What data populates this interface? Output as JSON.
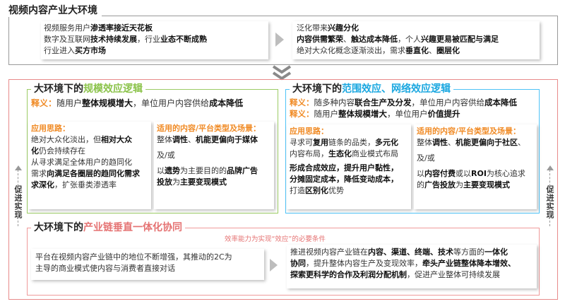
{
  "top": {
    "title": "视频内容产业大环境",
    "left": {
      "l1a": "视频服务用户",
      "l1b": "渗透率接近天花板",
      "l2a": "数字及互联网",
      "l2b": "技术持续发展",
      "l2c": "，行业",
      "l2d": "业态不断成熟",
      "l3a": "行业进入",
      "l3b": "买方市场"
    },
    "right": {
      "l1a": "泛化带来",
      "l1b": "兴趣分化",
      "l2a": "内容供需繁荣",
      "l2b": "、",
      "l2c": "触达成本降低",
      "l2d": "，个人",
      "l2e": "兴趣更易被匹配与满足",
      "l3a": "绝对大众化概念逐渐淡出，需求",
      "l3b": "垂直化",
      "l3c": "、",
      "l3d": "圈层化"
    }
  },
  "side": {
    "left_label": "促进实现",
    "right_label": "促进实现"
  },
  "scale": {
    "title_a": "大环境下的",
    "title_b": "规模效应逻辑",
    "def_k": "释义：",
    "def_a": "随用户",
    "def_b": "整体规模增大",
    "def_c": "，单位用户内容供给",
    "def_d": "成本降低",
    "idea_k": "应用思路：",
    "i1a": "绝对大众化淡出，但",
    "i1b": "相对大众",
    "i2a": "化",
    "i2b": "仍会持续存在",
    "i3": "从寻求满足全体用户的趋同化",
    "i4a": "需求",
    "i4b": "向满足各圈层的趋同化需求",
    "i5a": "求深化",
    "i5b": "，扩张垂类渗透率",
    "fit_k": "适用的内容/平台类型及场景：",
    "f1a": "整体",
    "f1b": "调性",
    "f1c": "、",
    "f1d": "机能更偏向于媒体",
    "f2": "及/或",
    "f3a": "以",
    "f3b": "遗势",
    "f3c": "为主要目的的",
    "f3d": "品牌广告",
    "f4a": "投放",
    "f4b": "为",
    "f4c": "主要变现模式"
  },
  "scope": {
    "title_a": "大环境下的",
    "title_b": "范围效应、网络效应逻辑",
    "d1k": "释义：",
    "d1a": "随多种内容",
    "d1b": "联合生产及分发",
    "d1c": "，单位用户内容供给",
    "d1d": "成本降低",
    "d2k": "释义：",
    "d2a": "随用户",
    "d2b": "整体规模增大",
    "d2c": "，单位用户",
    "d2d": "价值提升",
    "idea_k": "应用思路：",
    "i1a": "寻求可",
    "i1b": "复用",
    "i1c": "链条的品类，",
    "i1d": "多元化",
    "i2a": "内容布局，",
    "i2b": "生态化",
    "i2c": "商业模式布局",
    "i3": "形成合成效应，提升用户黏性，",
    "i4": "分摊固定成本，降低变动成本，",
    "i5a": "打造",
    "i5b": "区别化",
    "i5c": "优势",
    "fit_k": "适用的内容/平台类型及场景：",
    "f1a": "整体",
    "f1b": "调性",
    "f1c": "、",
    "f1d": "机能更偏向于社区",
    "f1e": "、",
    "f2": "及/或",
    "f3a": "以",
    "f3b": "内容付费",
    "f3c": "或以",
    "f3d": "ROI",
    "f3e": "为核心追求",
    "f4a": "的",
    "f4b": "广告投放",
    "f4c": "为",
    "f4d": "主要变现模式"
  },
  "chain": {
    "title_a": "大环境下的",
    "title_b": "产业链垂直一体化协同",
    "note": "效率能力为实现“效应”的必要条件",
    "l1": "平台在视频内容产业链中的地位不断增强，其推动的2C为",
    "l2": "主导的商业模式使内容与消费者直接对话",
    "r1a": "推进视频内容产业链在",
    "r1b": "内容、渠道、终端、技术",
    "r1c": "等方面的",
    "r1d": "一体化",
    "r2a": "协同",
    "r2b": "，提升整体内容生产及变现效率，",
    "r2c": "牵头产业链整体降本增效、",
    "r3a": "探索更科学的合作及利润分配机制",
    "r3b": "，促进产业整体可持续发展"
  }
}
